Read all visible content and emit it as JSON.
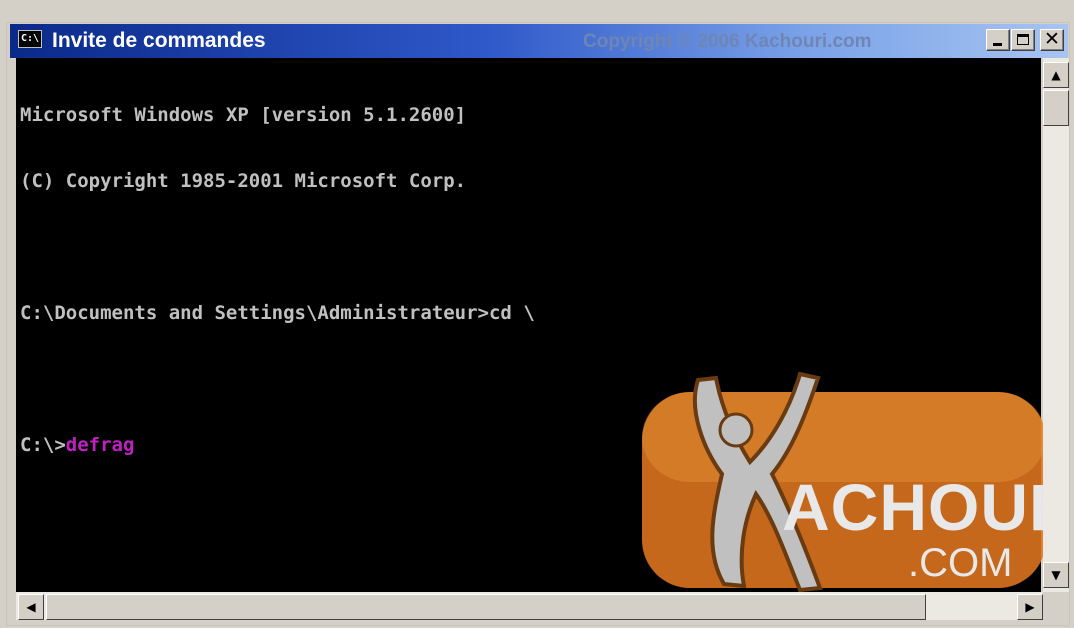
{
  "window": {
    "title": "Invite de commandes",
    "watermark_text": "Copyright © 2006 Kachouri.com",
    "system_icon": "C:\\",
    "controls": {
      "minimize_icon": "minimize-icon",
      "maximize_icon": "maximize-icon",
      "close_icon": "close-icon",
      "close_glyph": "✕"
    }
  },
  "console": {
    "lines": [
      "Microsoft Windows XP [version 5.1.2600]",
      "(C) Copyright 1985-2001 Microsoft Corp.",
      "",
      "C:\\Documents and Settings\\Administrateur>cd \\",
      ""
    ],
    "prompt": "C:\\>",
    "command": "defrag",
    "text_color": "#c0c0c0",
    "command_color": "#c020c0",
    "background": "#000000"
  },
  "logo": {
    "name": "ACHOURI",
    "suffix": ".COM",
    "color": "#e0761f"
  },
  "scrollbars": {
    "up_arrow": "▲",
    "down_arrow": "▼",
    "left_arrow": "◀",
    "right_arrow": "▶"
  }
}
